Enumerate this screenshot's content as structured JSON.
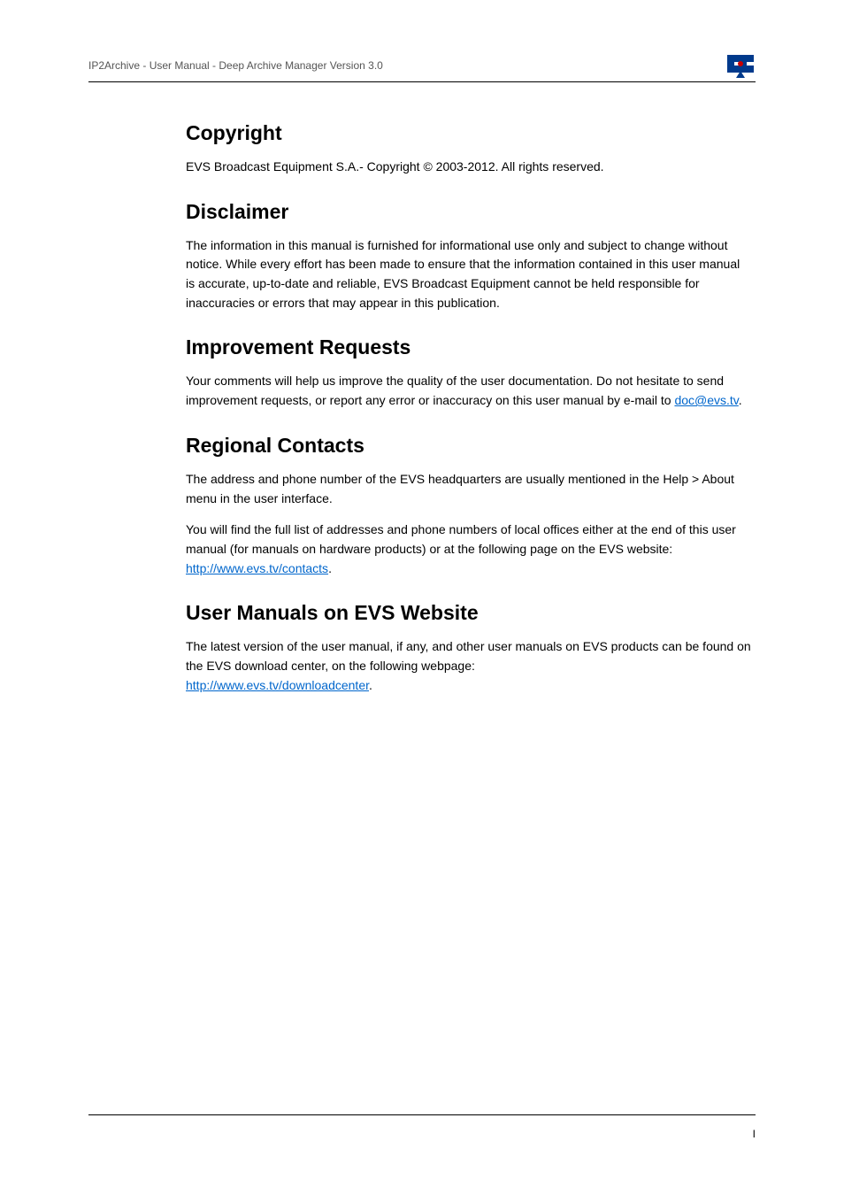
{
  "header": {
    "breadcrumb": "IP2Archive - User Manual - Deep Archive Manager Version 3.0"
  },
  "sections": {
    "copyright": {
      "title": "Copyright",
      "body": "EVS Broadcast Equipment S.A.- Copyright © 2003-2012. All rights reserved."
    },
    "disclaimer": {
      "title": "Disclaimer",
      "body": "The information in this manual is furnished for informational use only and subject to change without notice. While every effort has been made to ensure that the information contained in this user manual is accurate, up-to-date and reliable, EVS Broadcast Equipment cannot be held responsible for inaccuracies or errors that may appear in this publication."
    },
    "improvement": {
      "title": "Improvement Requests",
      "body_pre": "Your comments will help us improve the quality of the user documentation. Do not hesitate to send improvement requests, or report any error or inaccuracy on this user manual by e-mail to ",
      "link_text": "doc@evs.tv",
      "body_post": "."
    },
    "regional": {
      "title": "Regional Contacts",
      "p1": "The address and phone number of the EVS headquarters are usually mentioned in the Help > About menu in the user interface.",
      "p2_pre": "You will find the full list of addresses and phone numbers of local offices either at the end of this user manual (for manuals on hardware products) or at the following page on the EVS website: ",
      "p2_link": "http://www.evs.tv/contacts",
      "p2_post": "."
    },
    "manuals": {
      "title": "User Manuals on EVS Website",
      "p_pre": "The latest version of the user manual, if any, and other user manuals on EVS products can be found on the EVS download center, on the following webpage: ",
      "p_link": "http://www.evs.tv/downloadcenter",
      "p_post": "."
    }
  },
  "footer": {
    "page_number": "I"
  }
}
